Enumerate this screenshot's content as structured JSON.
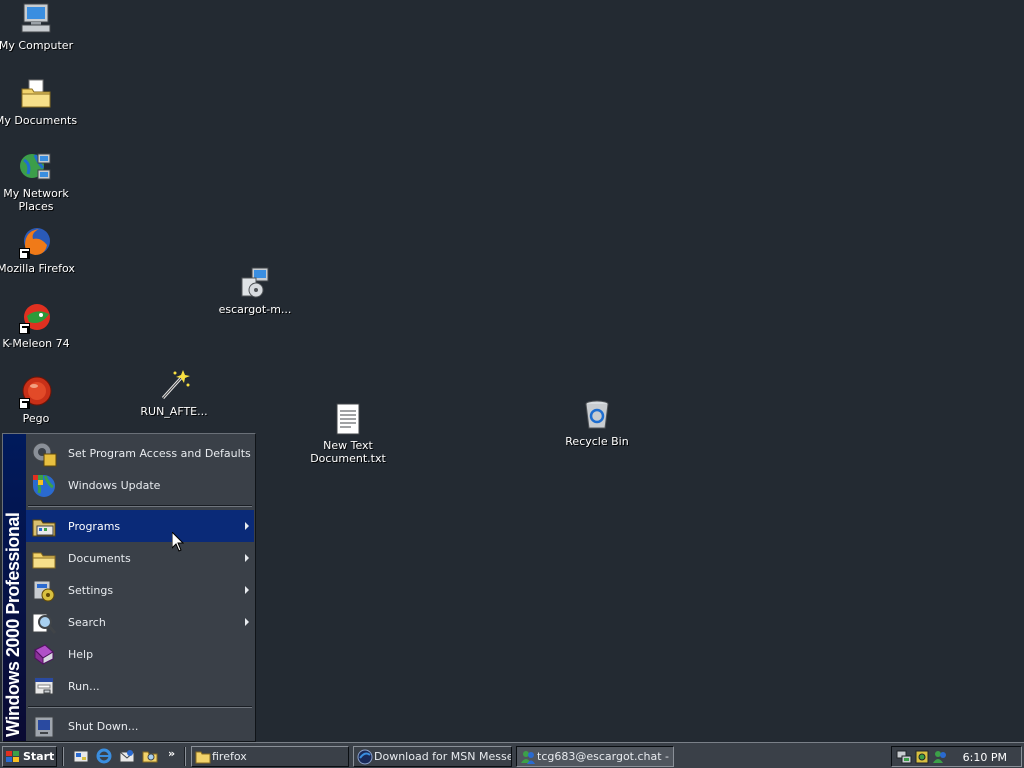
{
  "desktop": {
    "icons": [
      {
        "label": "My Computer",
        "icon": "my-computer-icon"
      },
      {
        "label": "My Documents",
        "icon": "my-documents-icon"
      },
      {
        "label": "My Network Places",
        "icon": "network-places-icon"
      },
      {
        "label": "Mozilla Firefox",
        "icon": "firefox-icon"
      },
      {
        "label": "K-Meleon 74",
        "icon": "k-meleon-icon"
      },
      {
        "label": "Pego",
        "icon": "pego-icon"
      },
      {
        "label": "escargot-m...",
        "icon": "installer-icon"
      },
      {
        "label": "RUN_AFTE...",
        "icon": "wand-icon"
      },
      {
        "label": "New Text Document.txt",
        "icon": "text-document-icon"
      },
      {
        "label": "Recycle Bin",
        "icon": "recycle-bin-icon"
      }
    ]
  },
  "start_menu": {
    "banner": "Windows 2000 Professional",
    "items": [
      {
        "label": "Set Program Access and Defaults",
        "icon": "program-access-icon",
        "submenu": false
      },
      {
        "label": "Windows Update",
        "icon": "windows-update-icon",
        "submenu": false
      },
      {
        "label": "Programs",
        "icon": "programs-icon",
        "submenu": true,
        "active": true
      },
      {
        "label": "Documents",
        "icon": "documents-folder-icon",
        "submenu": true
      },
      {
        "label": "Settings",
        "icon": "settings-icon",
        "submenu": true
      },
      {
        "label": "Search",
        "icon": "search-icon",
        "submenu": true
      },
      {
        "label": "Help",
        "icon": "help-icon",
        "submenu": false
      },
      {
        "label": "Run...",
        "icon": "run-icon",
        "submenu": false
      },
      {
        "label": "Shut Down...",
        "icon": "shutdown-icon",
        "submenu": false
      }
    ]
  },
  "taskbar": {
    "start_label": "Start",
    "quick_launch_more": "»",
    "tasks": [
      {
        "label": "firefox",
        "icon": "folder-icon"
      },
      {
        "label": "Download for MSN Messe...",
        "icon": "browser-icon"
      },
      {
        "label": "tcg683@escargot.chat - ...",
        "icon": "messenger-icon",
        "pressed": true
      }
    ],
    "clock": "6:10 PM"
  },
  "colors": {
    "desktop": "#232a32",
    "menu_bg": "#3a4048",
    "highlight": "#0a2a78"
  }
}
